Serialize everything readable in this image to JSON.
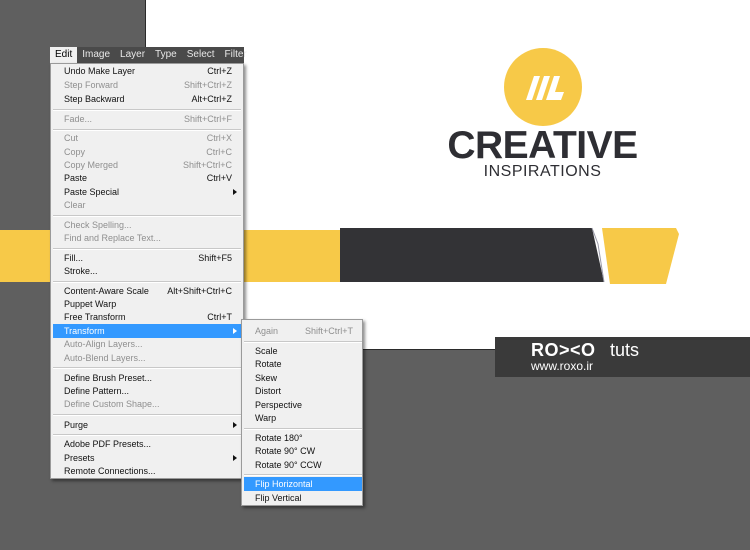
{
  "menubar": {
    "items": [
      "Edit",
      "Image",
      "Layer",
      "Type",
      "Select",
      "Filter"
    ]
  },
  "edit_menu": {
    "items": [
      {
        "label": "Undo Make Layer",
        "shortcut": "Ctrl+Z",
        "disabled": false
      },
      {
        "label": "Step Forward",
        "shortcut": "Shift+Ctrl+Z",
        "disabled": true
      },
      {
        "label": "Step Backward",
        "shortcut": "Alt+Ctrl+Z",
        "disabled": false
      },
      {
        "label": "Fade...",
        "shortcut": "Shift+Ctrl+F",
        "disabled": true
      },
      {
        "label": "Cut",
        "shortcut": "Ctrl+X",
        "disabled": true
      },
      {
        "label": "Copy",
        "shortcut": "Ctrl+C",
        "disabled": true
      },
      {
        "label": "Copy Merged",
        "shortcut": "Shift+Ctrl+C",
        "disabled": true
      },
      {
        "label": "Paste",
        "shortcut": "Ctrl+V",
        "disabled": false
      },
      {
        "label": "Paste Special",
        "shortcut": "",
        "disabled": false,
        "submenu": true
      },
      {
        "label": "Clear",
        "shortcut": "",
        "disabled": true
      },
      {
        "label": "Check Spelling...",
        "shortcut": "",
        "disabled": true
      },
      {
        "label": "Find and Replace Text...",
        "shortcut": "",
        "disabled": true
      },
      {
        "label": "Fill...",
        "shortcut": "Shift+F5",
        "disabled": false
      },
      {
        "label": "Stroke...",
        "shortcut": "",
        "disabled": false
      },
      {
        "label": "Content-Aware Scale",
        "shortcut": "Alt+Shift+Ctrl+C",
        "disabled": false
      },
      {
        "label": "Puppet Warp",
        "shortcut": "",
        "disabled": false
      },
      {
        "label": "Free Transform",
        "shortcut": "Ctrl+T",
        "disabled": false
      },
      {
        "label": "Transform",
        "shortcut": "",
        "disabled": false,
        "submenu": true,
        "highlight": true
      },
      {
        "label": "Auto-Align Layers...",
        "shortcut": "",
        "disabled": true
      },
      {
        "label": "Auto-Blend Layers...",
        "shortcut": "",
        "disabled": true
      },
      {
        "label": "Define Brush Preset...",
        "shortcut": "",
        "disabled": false
      },
      {
        "label": "Define Pattern...",
        "shortcut": "",
        "disabled": false
      },
      {
        "label": "Define Custom Shape...",
        "shortcut": "",
        "disabled": true
      },
      {
        "label": "Purge",
        "shortcut": "",
        "disabled": false,
        "submenu": true
      },
      {
        "label": "Adobe PDF Presets...",
        "shortcut": "",
        "disabled": false
      },
      {
        "label": "Presets",
        "shortcut": "",
        "disabled": false,
        "submenu": true
      },
      {
        "label": "Remote Connections...",
        "shortcut": "",
        "disabled": false
      }
    ]
  },
  "transform_menu": {
    "items": [
      {
        "label": "Again",
        "shortcut": "Shift+Ctrl+T",
        "disabled": true
      },
      {
        "label": "Scale",
        "shortcut": "",
        "disabled": false
      },
      {
        "label": "Rotate",
        "shortcut": "",
        "disabled": false
      },
      {
        "label": "Skew",
        "shortcut": "",
        "disabled": false
      },
      {
        "label": "Distort",
        "shortcut": "",
        "disabled": false
      },
      {
        "label": "Perspective",
        "shortcut": "",
        "disabled": false
      },
      {
        "label": "Warp",
        "shortcut": "",
        "disabled": false
      },
      {
        "label": "Rotate 180°",
        "shortcut": "",
        "disabled": false
      },
      {
        "label": "Rotate 90° CW",
        "shortcut": "",
        "disabled": false
      },
      {
        "label": "Rotate 90° CCW",
        "shortcut": "",
        "disabled": false
      },
      {
        "label": "Flip Horizontal",
        "shortcut": "",
        "disabled": false,
        "highlight": true
      },
      {
        "label": "Flip Vertical",
        "shortcut": "",
        "disabled": false
      }
    ]
  },
  "artwork": {
    "logo_title": "CREATIVE",
    "logo_subtitle": "INSPIRATIONS",
    "brand_yellow": "#f7c948",
    "brand_dark": "#333336"
  },
  "watermark": {
    "logo": "RO><O",
    "tuts": "tuts",
    "url": "www.roxo.ir"
  }
}
